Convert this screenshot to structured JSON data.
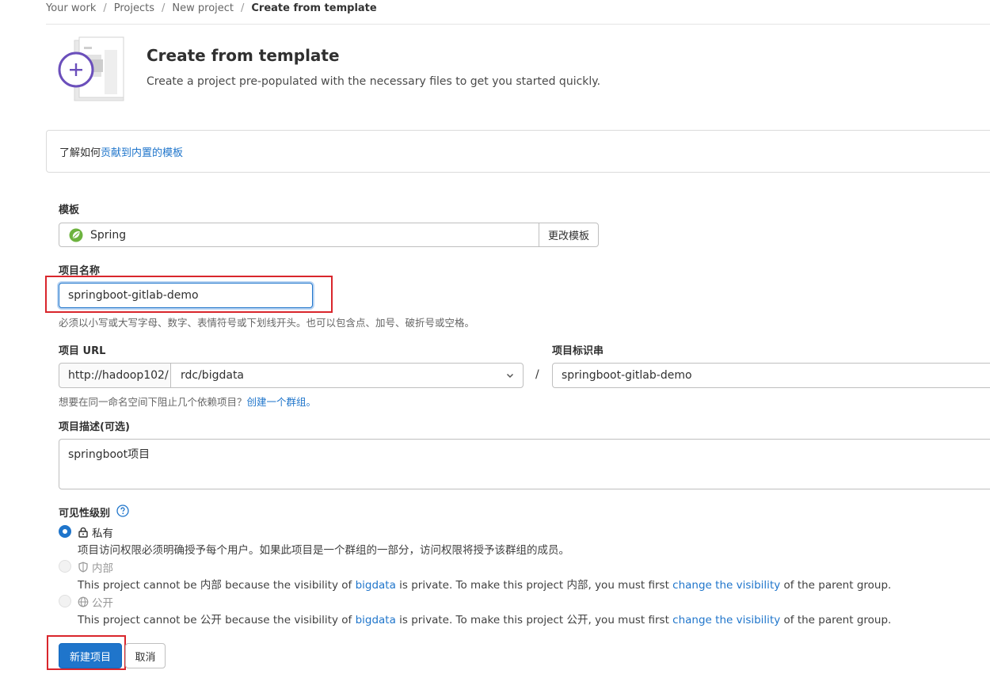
{
  "breadcrumb": {
    "items": [
      "Your work",
      "Projects",
      "New project"
    ],
    "current": "Create from template"
  },
  "header": {
    "title": "Create from template",
    "subtitle": "Create a project pre-populated with the necessary files to get you started quickly."
  },
  "info": {
    "text": "了解如何 ",
    "link": "贡献到内置的模板"
  },
  "template": {
    "label": "模板",
    "value": "Spring",
    "icon": "spring-leaf-icon",
    "change_button": "更改模板"
  },
  "project_name": {
    "label": "项目名称",
    "value": "springboot-gitlab-demo",
    "help": "必须以小写或大写字母、数字、表情符号或下划线开头。也可以包含点、加号、破折号或空格。"
  },
  "project_url": {
    "label": "项目 URL",
    "prefix": "http://hadoop102/",
    "namespace": "rdc/bigdata",
    "separator": "/",
    "help": "想要在同一命名空间下阻止几个依赖项目？",
    "help_link": "创建一个群组。"
  },
  "slug": {
    "label": "项目标识串",
    "value": "springboot-gitlab-demo"
  },
  "description": {
    "label": "项目描述(可选)",
    "value": "springboot项目"
  },
  "visibility": {
    "label": "可见性级别",
    "options": [
      {
        "label": "私有",
        "icon": "lock-icon",
        "checked": true,
        "disabled": false,
        "description": "项目访问权限必须明确授予每个用户。如果此项目是一个群组的一部分，访问权限将授予该群组的成员。"
      },
      {
        "label": "内部",
        "icon": "shield-icon",
        "checked": false,
        "disabled": true,
        "desc_a": "This project cannot be 内部 because the visibility of ",
        "desc_link1": "bigdata",
        "desc_b": " is private. To make this project 内部, you must first ",
        "desc_link2": "change the visibility",
        "desc_c": " of the parent group."
      },
      {
        "label": "公开",
        "icon": "earth-icon",
        "checked": false,
        "disabled": true,
        "desc_a": "This project cannot be 公开 because the visibility of ",
        "desc_link1": "bigdata",
        "desc_b": " is private. To make this project 公开, you must first ",
        "desc_link2": "change the visibility",
        "desc_c": " of the parent group."
      }
    ]
  },
  "actions": {
    "create": "新建项目",
    "cancel": "取消"
  },
  "colors": {
    "accent": "#1f75cb",
    "highlight": "#d9262c",
    "template_icon": "#6b4fbb",
    "spring": "#6db33f"
  }
}
